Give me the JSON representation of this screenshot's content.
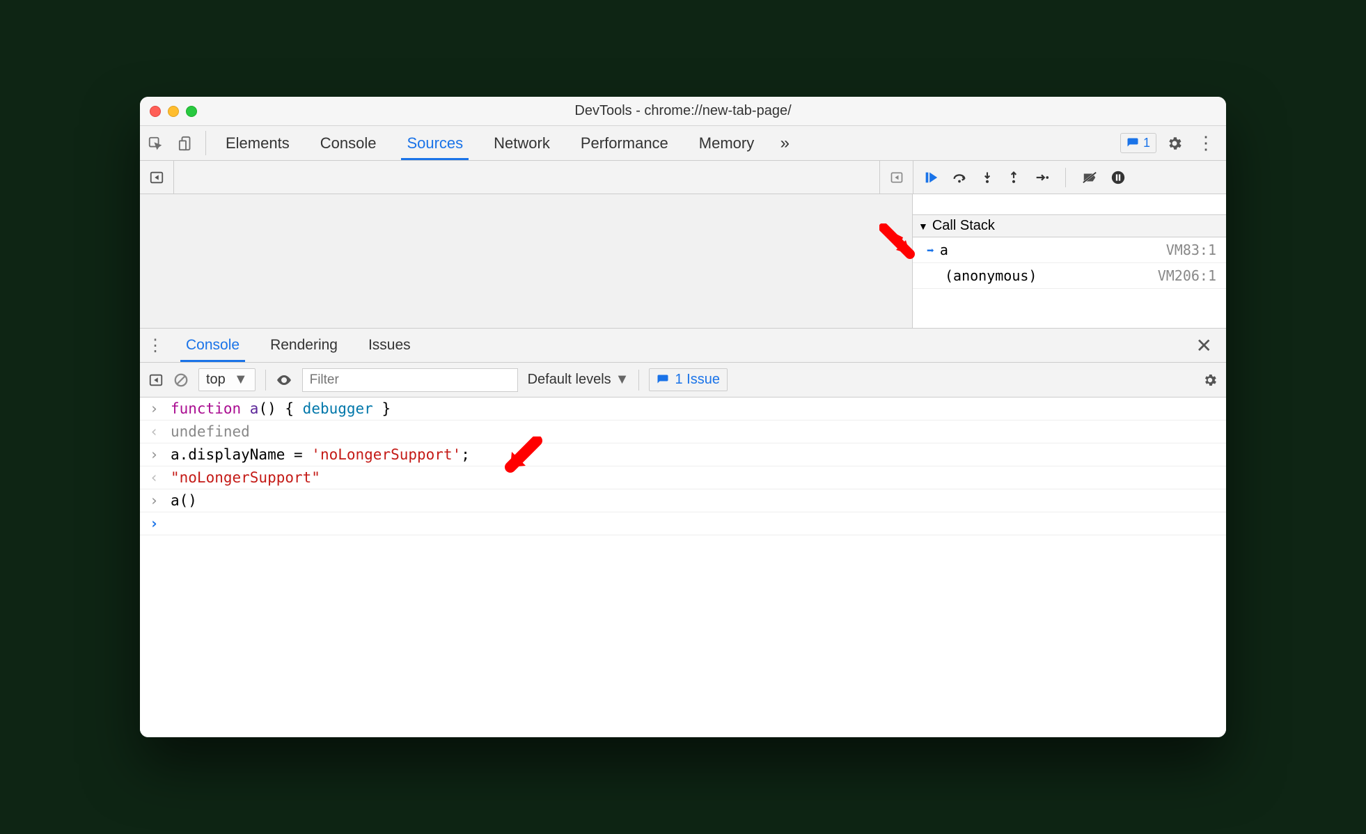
{
  "window": {
    "title": "DevTools - chrome://new-tab-page/"
  },
  "main_tabs": {
    "items": [
      "Elements",
      "Console",
      "Sources",
      "Network",
      "Performance",
      "Memory"
    ],
    "active": "Sources",
    "more": "»"
  },
  "toolbar_right": {
    "issue_count": "1"
  },
  "debugger": {
    "scope_partial_left": "",
    "scope_partial_right": "",
    "call_stack_label": "Call Stack",
    "stack": [
      {
        "name": "a",
        "location": "VM83:1",
        "current": true
      },
      {
        "name": "(anonymous)",
        "location": "VM206:1",
        "current": false
      }
    ]
  },
  "drawer": {
    "tabs": [
      "Console",
      "Rendering",
      "Issues"
    ],
    "active": "Console"
  },
  "console_toolbar": {
    "context": "top",
    "filter_placeholder": "Filter",
    "levels": "Default levels",
    "issue_text": "1 Issue"
  },
  "console": {
    "rows": [
      {
        "type": "in",
        "tokens": [
          [
            "kw",
            "function"
          ],
          [
            "",
            ""
          ],
          [
            "fn",
            " a"
          ],
          [
            "",
            "() { "
          ],
          [
            "debugger",
            "debugger"
          ],
          [
            "",
            " }"
          ]
        ]
      },
      {
        "type": "out",
        "tokens": [
          [
            "undef",
            "undefined"
          ]
        ]
      },
      {
        "type": "in",
        "tokens": [
          [
            "",
            "a.displayName = "
          ],
          [
            "str",
            "'noLongerSupport'"
          ],
          [
            "",
            ";"
          ]
        ]
      },
      {
        "type": "out",
        "tokens": [
          [
            "str",
            "\"noLongerSupport\""
          ]
        ]
      },
      {
        "type": "in",
        "tokens": [
          [
            "",
            "a()"
          ]
        ]
      },
      {
        "type": "prompt",
        "tokens": []
      }
    ]
  },
  "colors": {
    "accent": "#1a73e8",
    "error": "#f00"
  }
}
